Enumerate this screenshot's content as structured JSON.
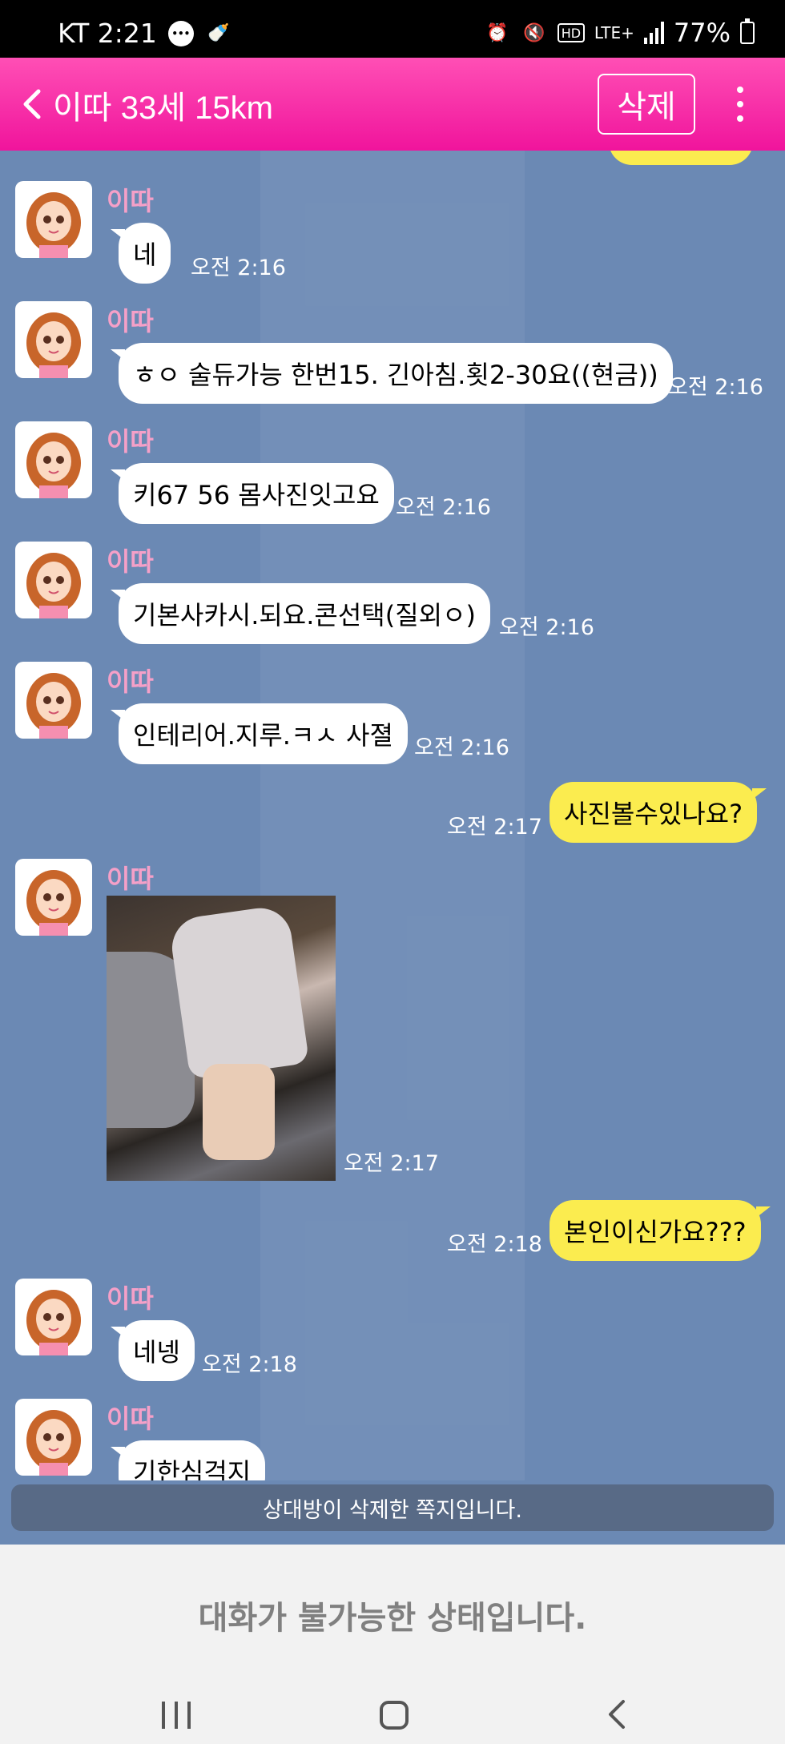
{
  "status_bar": {
    "carrier_time": "KT 2:21",
    "network": "LTE+",
    "battery": "77%"
  },
  "header": {
    "title": "이따 33세 15km",
    "delete_label": "삭제"
  },
  "messages": [
    {
      "from": "partner",
      "sender": "이따",
      "text": "네",
      "time": "오전 2:16"
    },
    {
      "from": "partner",
      "sender": "이따",
      "text": "ㅎㅇ 술듀가능 한번15. 긴아침.횟2-30요((현금))",
      "time": "오전 2:16"
    },
    {
      "from": "partner",
      "sender": "이따",
      "text": "키67 56 몸사진잇고요",
      "time": "오전 2:16"
    },
    {
      "from": "partner",
      "sender": "이따",
      "text": "기본사카시.되요.콘선택(질외ㅇ)",
      "time": "오전 2:16"
    },
    {
      "from": "partner",
      "sender": "이따",
      "text": "인테리어.지루.ㅋㅅ 사졀",
      "time": "오전 2:16"
    },
    {
      "from": "me",
      "text": "사진볼수있나요?",
      "time": "오전 2:17"
    },
    {
      "from": "partner",
      "sender": "이따",
      "type": "photo",
      "time": "오전 2:17"
    },
    {
      "from": "me",
      "text": "본인이신가요???",
      "time": "오전 2:18"
    },
    {
      "from": "partner",
      "sender": "이따",
      "text": "네넹",
      "time": "오전 2:18"
    },
    {
      "from": "partner",
      "sender": "이따",
      "text": "기한심걱지",
      "time": ""
    }
  ],
  "deleted_notice": "상대방이 삭제한 쪽지입니다.",
  "unavailable_notice": "대화가 불가능한 상태입니다.",
  "colors": {
    "header": "#f0149c",
    "chat_bg": "#6b89b4",
    "my_bubble": "#fbec4f",
    "partner_bubble": "#ffffff",
    "sender_name": "#f5a0c8"
  }
}
